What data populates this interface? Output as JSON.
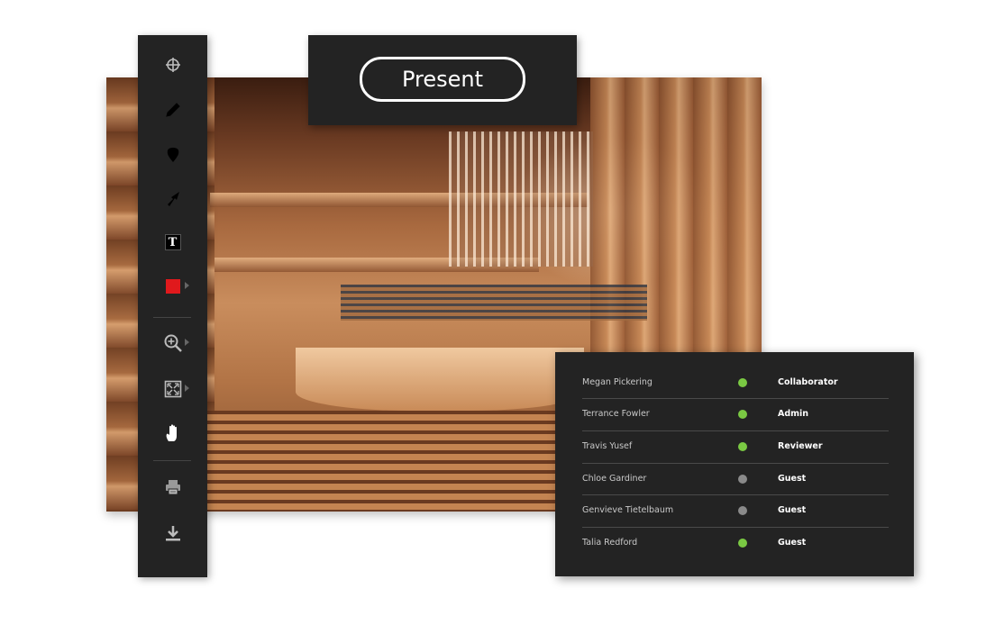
{
  "present_button": {
    "label": "Present"
  },
  "toolbar": {
    "tools": [
      {
        "name": "crosshair-icon",
        "glyph": "crosshair"
      },
      {
        "name": "pencil-icon",
        "glyph": "pencil"
      },
      {
        "name": "pin-icon",
        "glyph": "pin"
      },
      {
        "name": "arrow-icon",
        "glyph": "arrow"
      },
      {
        "name": "text-tool-icon",
        "glyph": "T"
      },
      {
        "name": "color-swatch",
        "color": "#e0191c"
      },
      {
        "name": "zoom-in-icon",
        "glyph": "zoom-in"
      },
      {
        "name": "fit-screen-icon",
        "glyph": "fit"
      },
      {
        "name": "hand-icon",
        "glyph": "hand"
      },
      {
        "name": "print-icon",
        "glyph": "print"
      },
      {
        "name": "download-icon",
        "glyph": "download"
      }
    ],
    "text_tool_letter": "T"
  },
  "users": [
    {
      "name": "Megan Pickering",
      "status": "online",
      "role": "Collaborator"
    },
    {
      "name": "Terrance Fowler",
      "status": "online",
      "role": "Admin"
    },
    {
      "name": "Travis Yusef",
      "status": "online",
      "role": "Reviewer"
    },
    {
      "name": "Chloe Gardiner",
      "status": "offline",
      "role": "Guest"
    },
    {
      "name": "Genvieve Tietelbaum",
      "status": "offline",
      "role": "Guest"
    },
    {
      "name": "Talia Redford",
      "status": "online",
      "role": "Guest"
    }
  ],
  "colors": {
    "online": "#7ac943",
    "offline": "#8a8a8a",
    "panel": "#232323",
    "accent_red": "#e0191c"
  }
}
